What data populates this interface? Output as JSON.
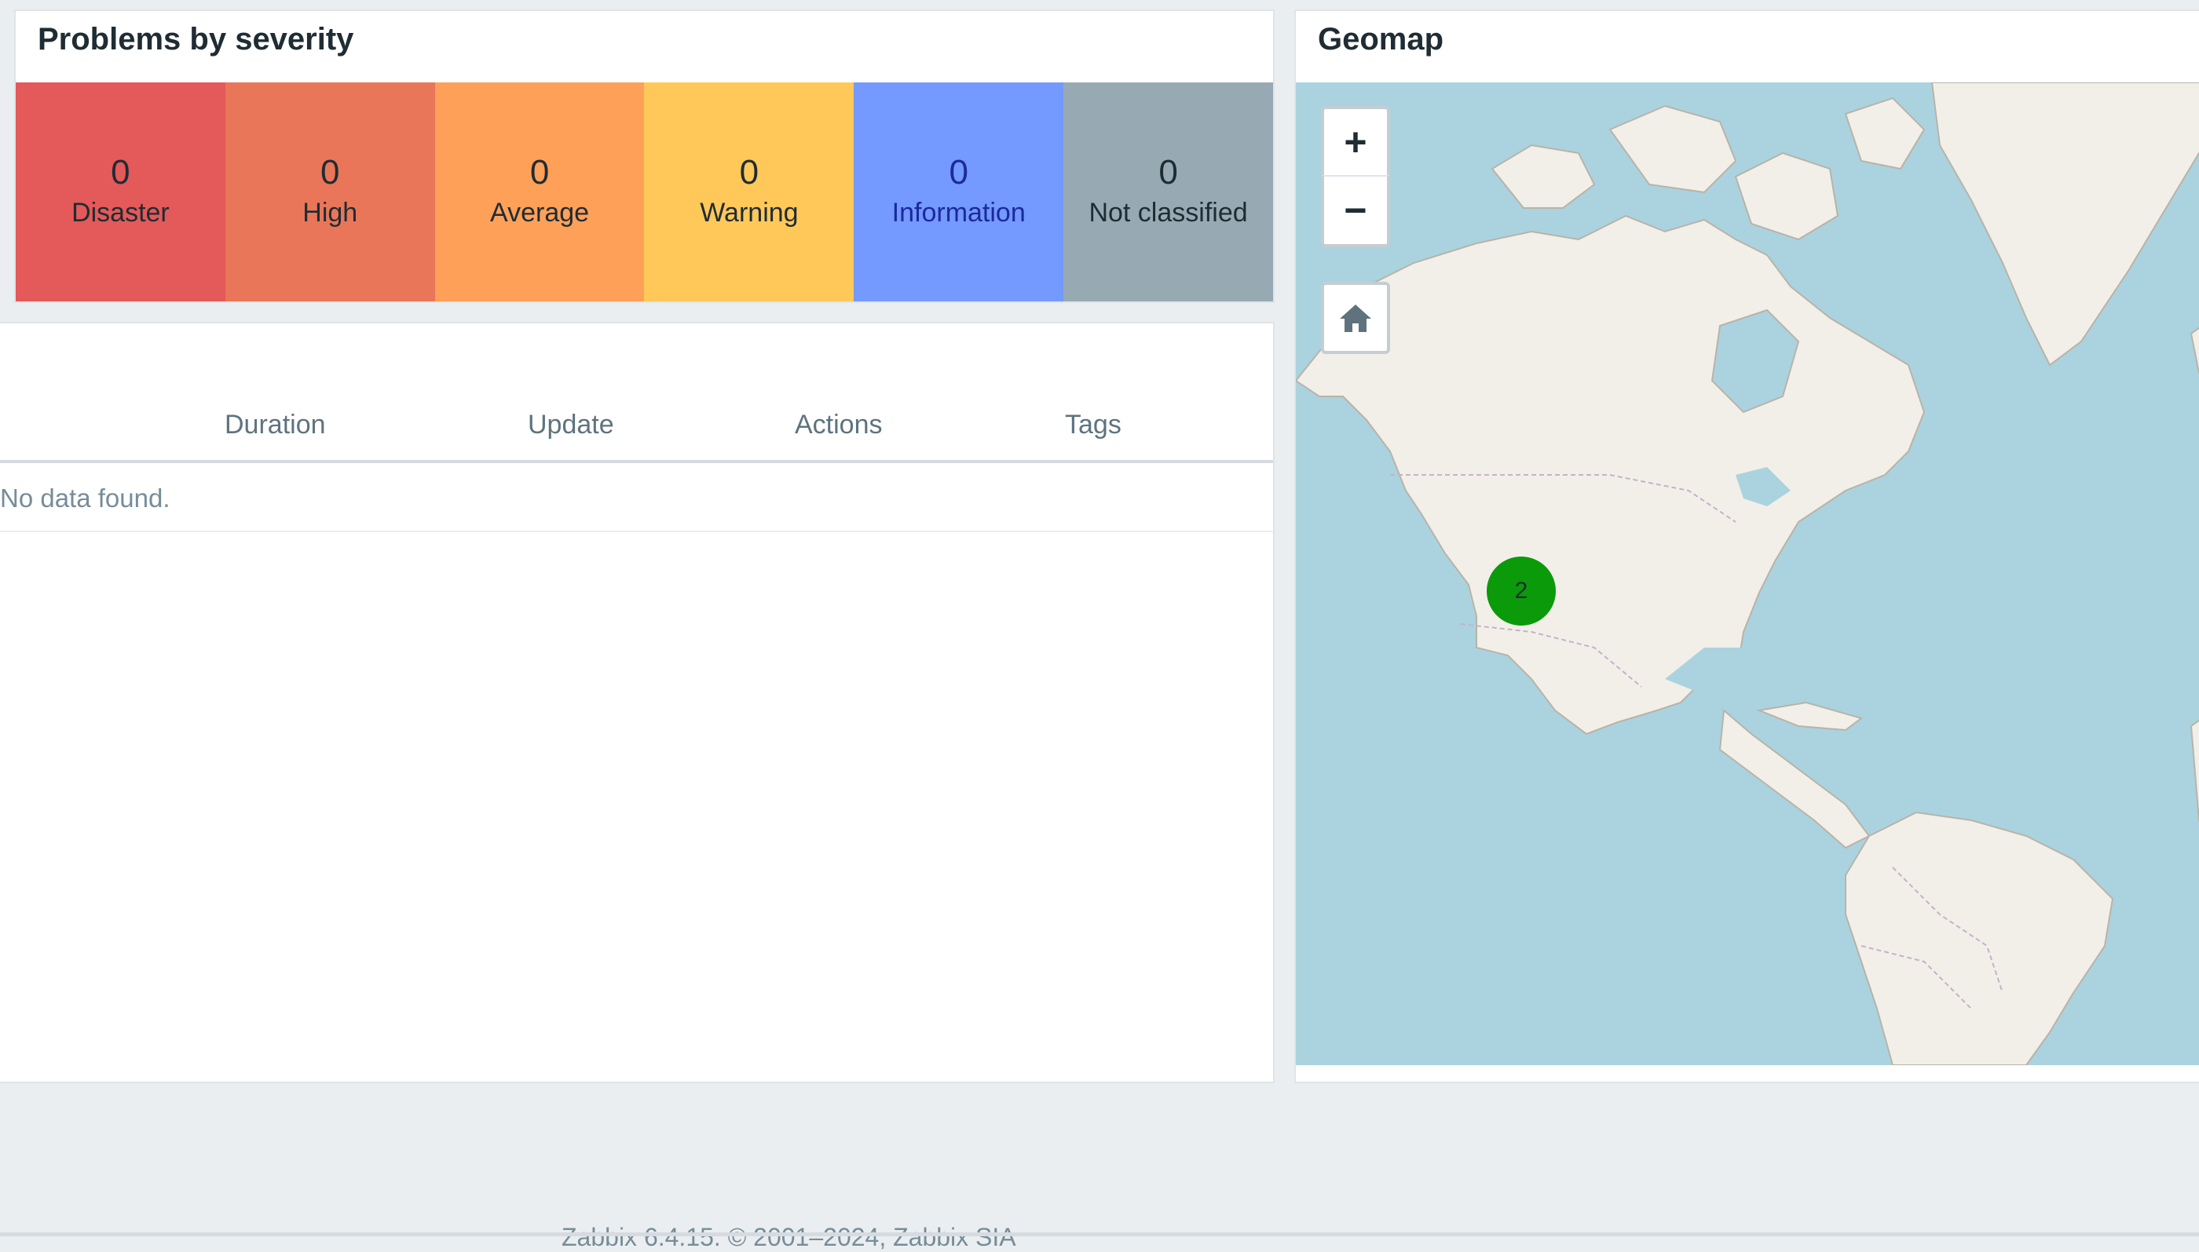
{
  "severity_widget": {
    "title": "Problems by severity",
    "items": [
      {
        "count": "0",
        "label": "Disaster",
        "color": "#e45959"
      },
      {
        "count": "0",
        "label": "High",
        "color": "#e97659"
      },
      {
        "count": "0",
        "label": "Average",
        "color": "#ffa059"
      },
      {
        "count": "0",
        "label": "Warning",
        "color": "#ffc859"
      },
      {
        "count": "0",
        "label": "Information",
        "color": "#7499ff"
      },
      {
        "count": "0",
        "label": "Not classified",
        "color": "#97aab3"
      }
    ]
  },
  "problems_table": {
    "columns": [
      "Duration",
      "Update",
      "Actions",
      "Tags"
    ],
    "empty_text": "No data found."
  },
  "geomap": {
    "title": "Geomap",
    "zoom_in_label": "+",
    "zoom_out_label": "−",
    "home_icon": "home-icon",
    "cluster_count": "2",
    "cluster_color": "#0a9a0a",
    "water_color": "#aad3df",
    "land_color": "#f2efe9"
  },
  "footer": {
    "text": "Zabbix 6.4.15. © 2001–2024, Zabbix SIA"
  }
}
